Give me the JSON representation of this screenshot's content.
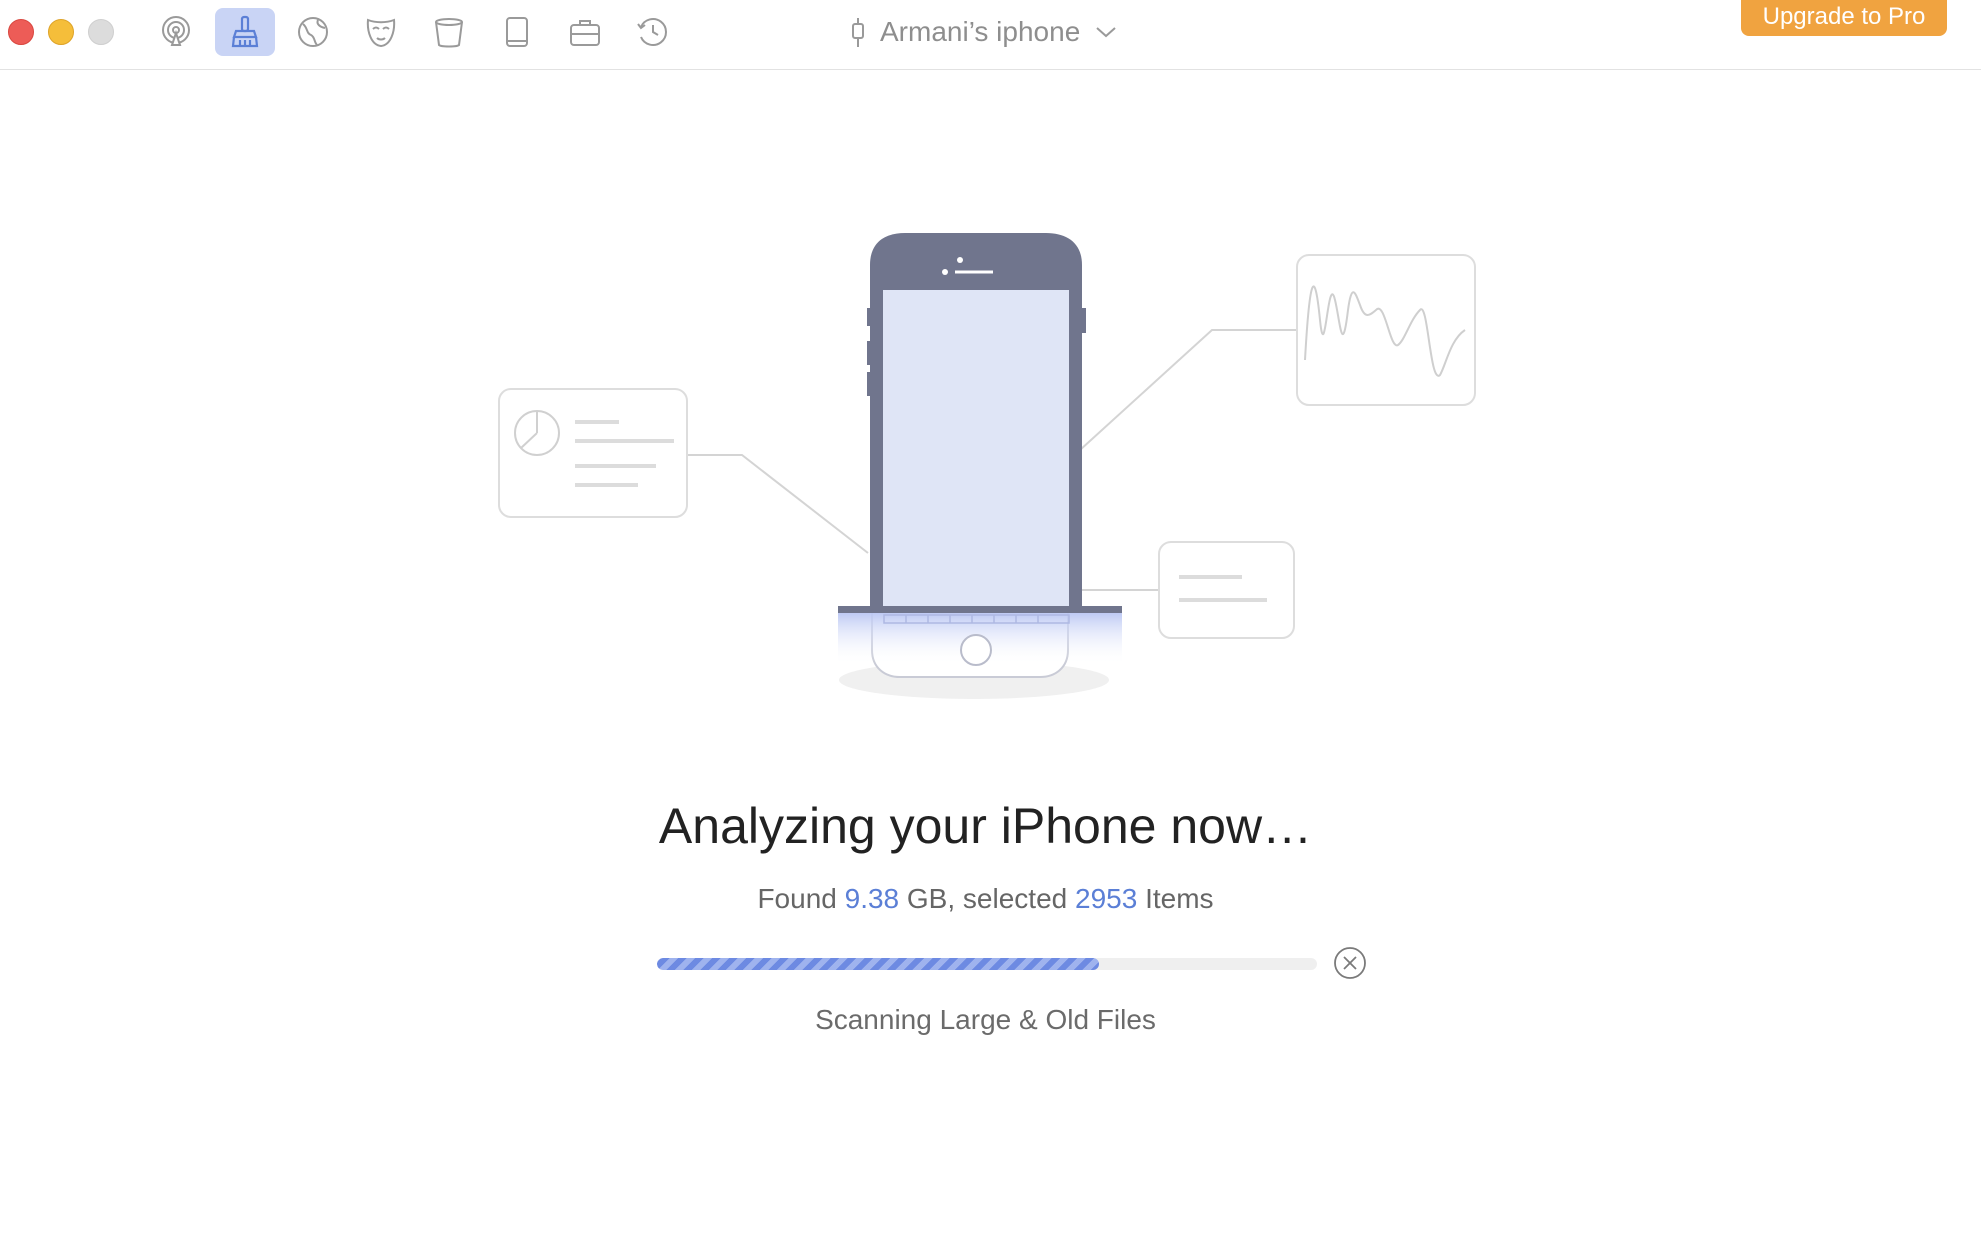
{
  "toolbar": {
    "items": [
      {
        "icon": "airplay-icon",
        "active": false
      },
      {
        "icon": "broom-icon",
        "active": true
      },
      {
        "icon": "globe-icon",
        "active": false
      },
      {
        "icon": "mask-icon",
        "active": false
      },
      {
        "icon": "trash-bin-icon",
        "active": false
      },
      {
        "icon": "book-icon",
        "active": false
      },
      {
        "icon": "briefcase-icon",
        "active": false
      },
      {
        "icon": "history-clock-icon",
        "active": false
      }
    ],
    "accent": "#5b7fd6"
  },
  "device": {
    "name": "Armani’s iphone",
    "icon": "usb-cable-icon",
    "dropdown_icon": "chevron-down-icon"
  },
  "upgrade": {
    "label": "Upgrade to Pro",
    "color": "#f0a340"
  },
  "main": {
    "heading": "Analyzing your iPhone now…",
    "summary": {
      "prefix": "Found ",
      "size": "9.38",
      "middle": " GB, selected ",
      "count": "2953",
      "suffix": " Items"
    },
    "progress": 0.67,
    "cancel_icon": "close-circle-icon",
    "scan_status": "Scanning Large & Old Files"
  }
}
